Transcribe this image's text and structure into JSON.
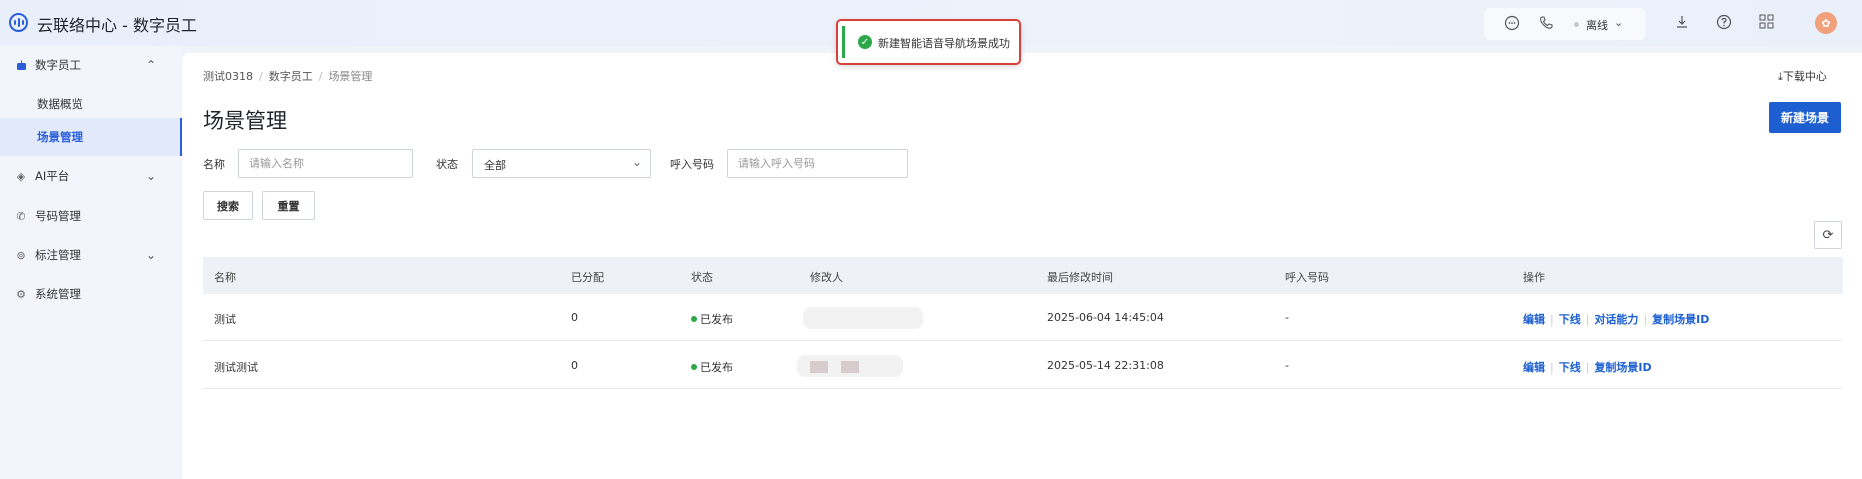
{
  "app": {
    "title": "云联络中心 - 数字员工"
  },
  "topbar": {
    "status": "离线"
  },
  "toast": {
    "message": "新建智能语音导航场景成功"
  },
  "sidebar": {
    "items": [
      {
        "label": "数字员工",
        "icon": "robot-icon",
        "expanded": true
      },
      {
        "label": "数据概览",
        "sub": true
      },
      {
        "label": "场景管理",
        "sub": true,
        "active": true
      },
      {
        "label": "AI平台",
        "icon": "ai-icon",
        "expanded": false
      },
      {
        "label": "号码管理",
        "icon": "phone-icon"
      },
      {
        "label": "标注管理",
        "icon": "tag-icon",
        "expanded": false
      },
      {
        "label": "系统管理",
        "icon": "settings-icon"
      }
    ]
  },
  "breadcrumb": [
    "测试0318",
    "数字员工",
    "场景管理"
  ],
  "download_center": "下载中心",
  "page_title": "场景管理",
  "new_button": "新建场景",
  "filters": {
    "name_label": "名称",
    "name_placeholder": "请输入名称",
    "status_label": "状态",
    "status_value": "全部",
    "number_label": "呼入号码",
    "number_placeholder": "请输入呼入号码",
    "search_button": "搜索",
    "reset_button": "重置"
  },
  "table": {
    "columns": [
      "名称",
      "已分配",
      "状态",
      "修改人",
      "最后修改时间",
      "呼入号码",
      "操作"
    ],
    "rows": [
      {
        "name": "测试",
        "assigned": "0",
        "status": "已发布",
        "modified": "2025-06-04 14:45:04",
        "number": "-",
        "actions": [
          "编辑",
          "下线",
          "对话能力",
          "复制场景ID"
        ]
      },
      {
        "name": "测试测试",
        "assigned": "0",
        "status": "已发布",
        "modified": "2025-05-14 22:31:08",
        "number": "-",
        "actions": [
          "编辑",
          "下线",
          "复制场景ID"
        ]
      }
    ]
  },
  "colors": {
    "primary": "#1d5fd0",
    "success": "#2ca849",
    "toast_border": "#d9403a"
  }
}
